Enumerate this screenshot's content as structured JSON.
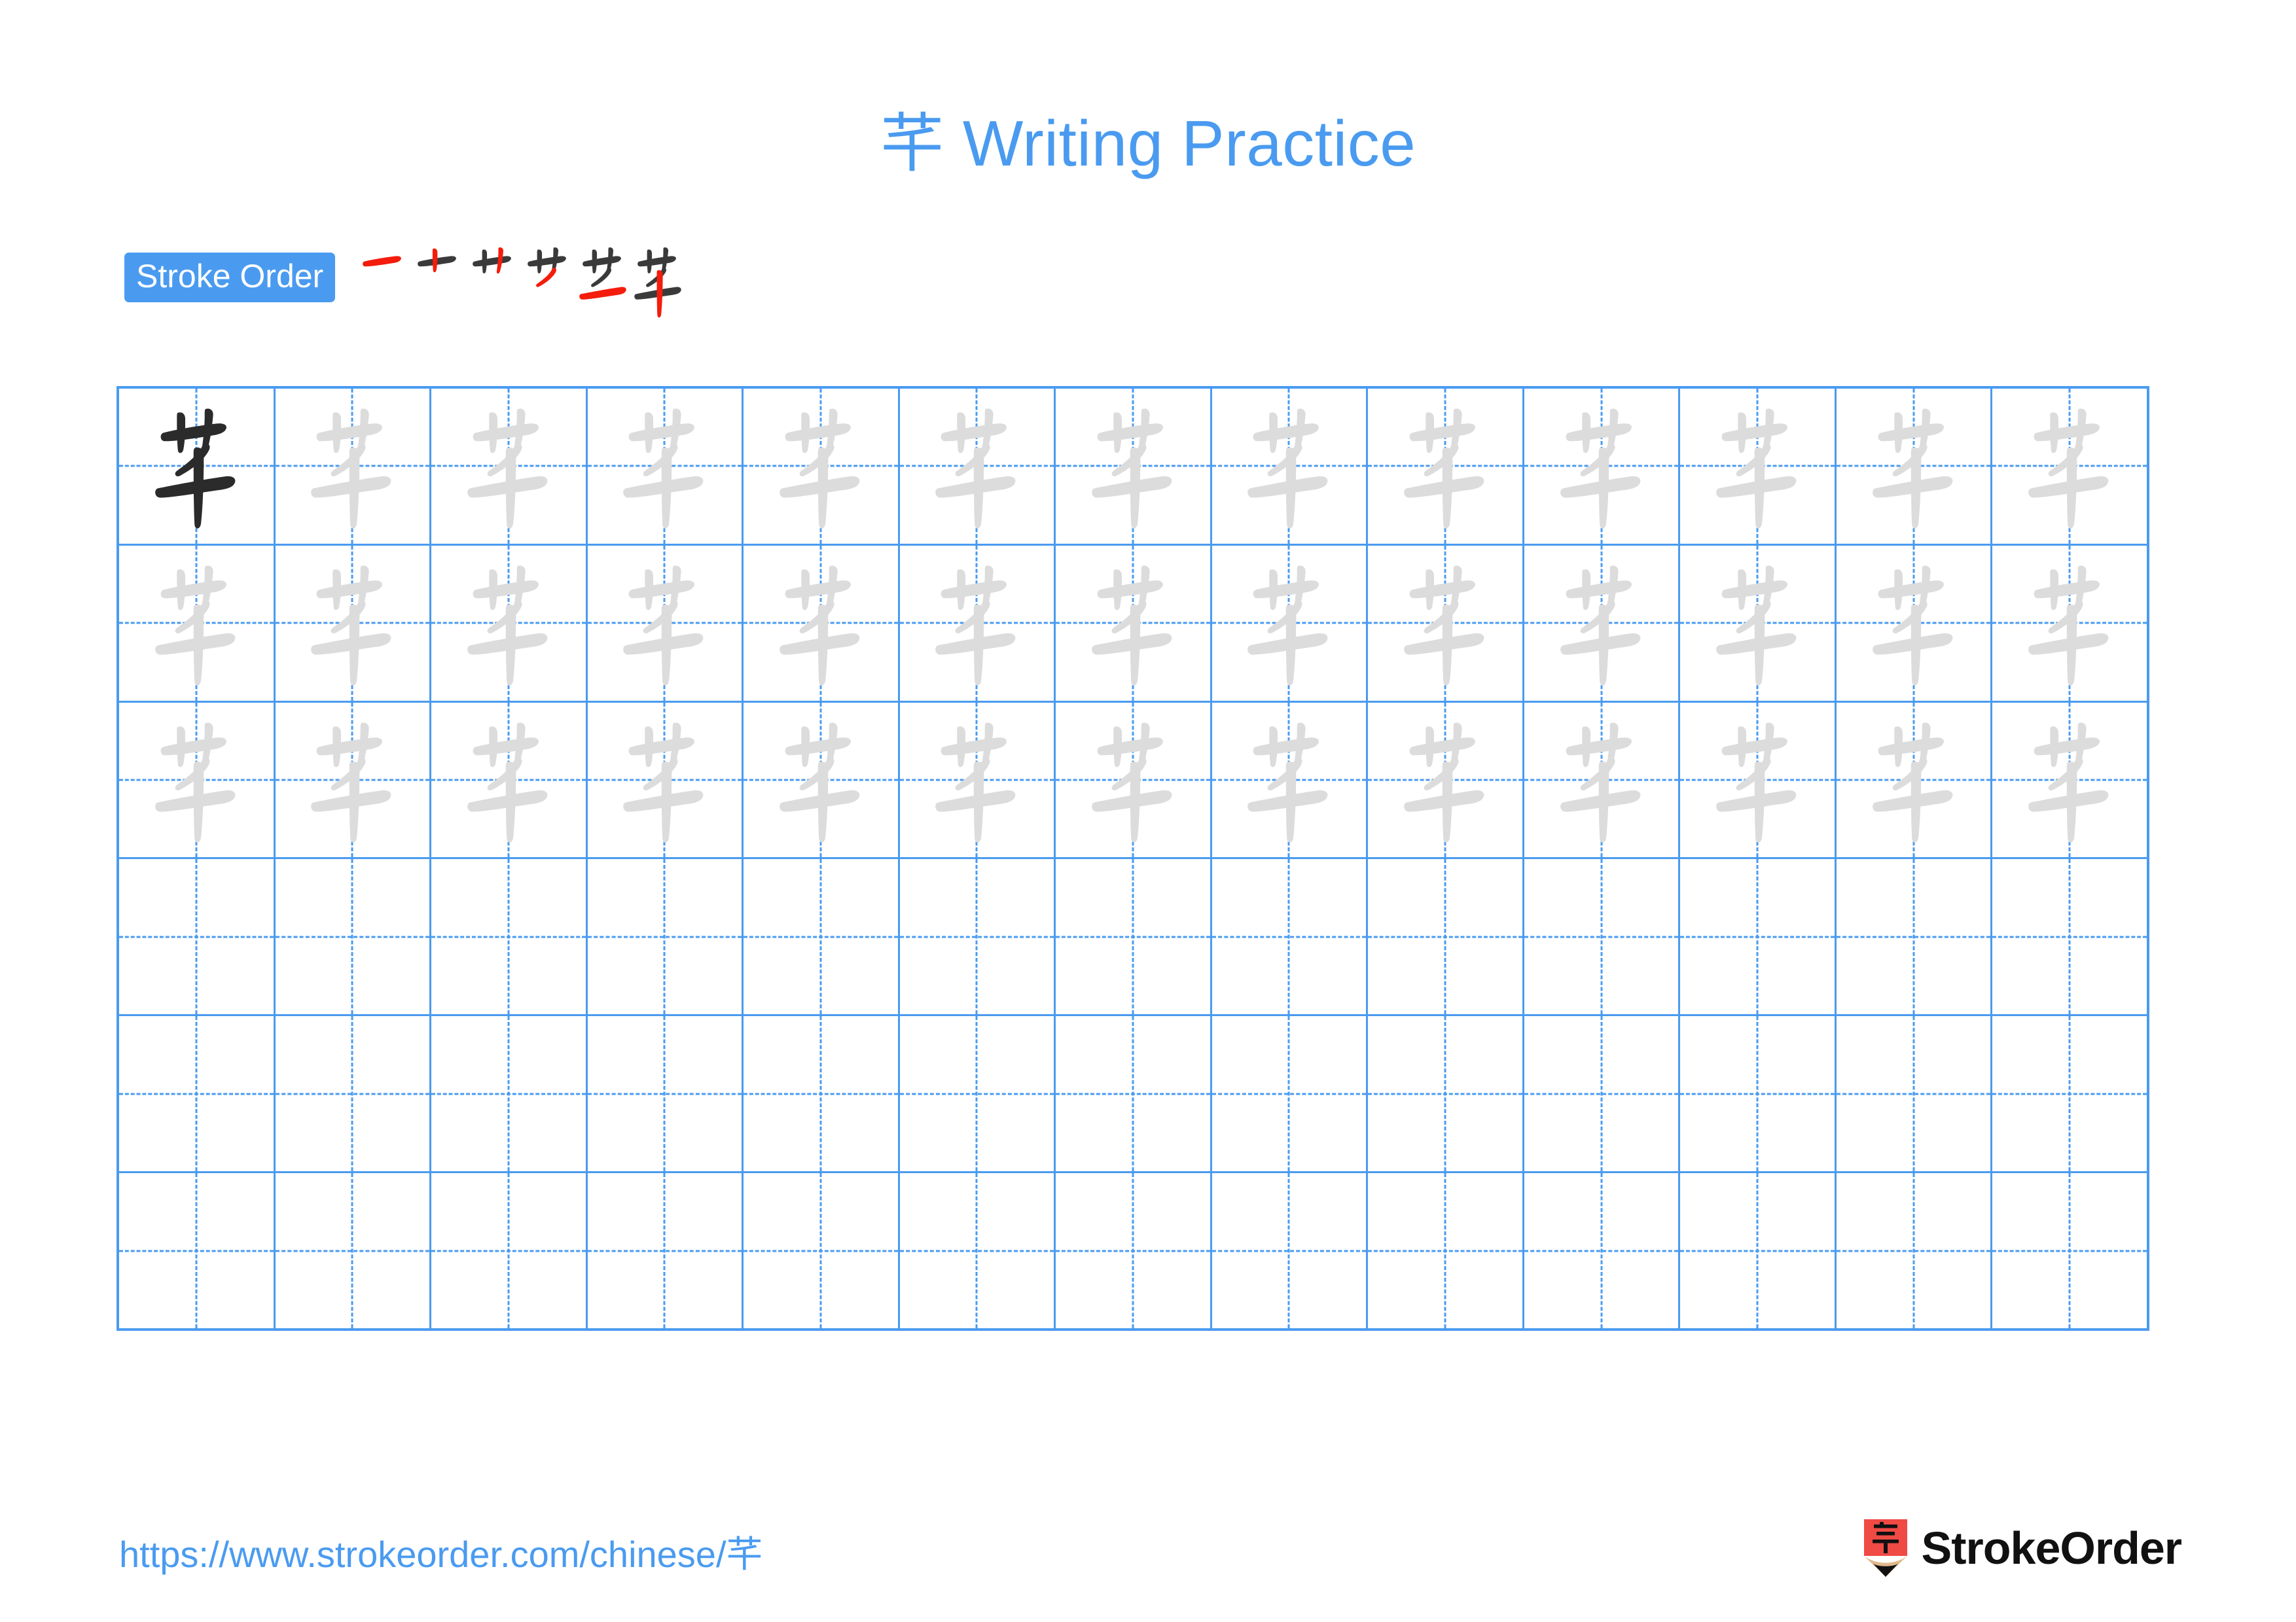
{
  "page": {
    "character": "芊",
    "background_color": "#ffffff",
    "accent_color": "#4a9bf0",
    "trace_color": "#dcdcdc",
    "ink_color": "#2b2b2b",
    "highlight_stroke_color": "#f41c0c"
  },
  "header": {
    "title_character": "芊",
    "title_text": " Writing Practice"
  },
  "stroke_order": {
    "badge_label": "Stroke Order",
    "stroke_count": 6,
    "steps": [
      {
        "index": 1,
        "new_stroke": "heng",
        "description": "horizontal"
      },
      {
        "index": 2,
        "new_stroke": "shu",
        "description": "vertical left of grass radical"
      },
      {
        "index": 3,
        "new_stroke": "shu",
        "description": "vertical right of grass radical"
      },
      {
        "index": 4,
        "new_stroke": "pie",
        "description": "left falling"
      },
      {
        "index": 5,
        "new_stroke": "heng",
        "description": "long horizontal"
      },
      {
        "index": 6,
        "new_stroke": "shu",
        "description": "long vertical stem"
      }
    ]
  },
  "grid": {
    "columns": 13,
    "rows": 6,
    "cells": [
      [
        "ink",
        "trace",
        "trace",
        "trace",
        "trace",
        "trace",
        "trace",
        "trace",
        "trace",
        "trace",
        "trace",
        "trace",
        "trace"
      ],
      [
        "trace",
        "trace",
        "trace",
        "trace",
        "trace",
        "trace",
        "trace",
        "trace",
        "trace",
        "trace",
        "trace",
        "trace",
        "trace"
      ],
      [
        "trace",
        "trace",
        "trace",
        "trace",
        "trace",
        "trace",
        "trace",
        "trace",
        "trace",
        "trace",
        "trace",
        "trace",
        "trace"
      ],
      [
        "empty",
        "empty",
        "empty",
        "empty",
        "empty",
        "empty",
        "empty",
        "empty",
        "empty",
        "empty",
        "empty",
        "empty",
        "empty"
      ],
      [
        "empty",
        "empty",
        "empty",
        "empty",
        "empty",
        "empty",
        "empty",
        "empty",
        "empty",
        "empty",
        "empty",
        "empty",
        "empty"
      ],
      [
        "empty",
        "empty",
        "empty",
        "empty",
        "empty",
        "empty",
        "empty",
        "empty",
        "empty",
        "empty",
        "empty",
        "empty",
        "empty"
      ]
    ]
  },
  "footer": {
    "url_prefix": "https://www.strokeorder.com/chinese/",
    "url_character": "芊",
    "brand_name": "StrokeOrder",
    "brand_mark_character": "字",
    "brand_mark_body_color": "#f04a45",
    "brand_mark_wood_color": "#e0b98d"
  }
}
